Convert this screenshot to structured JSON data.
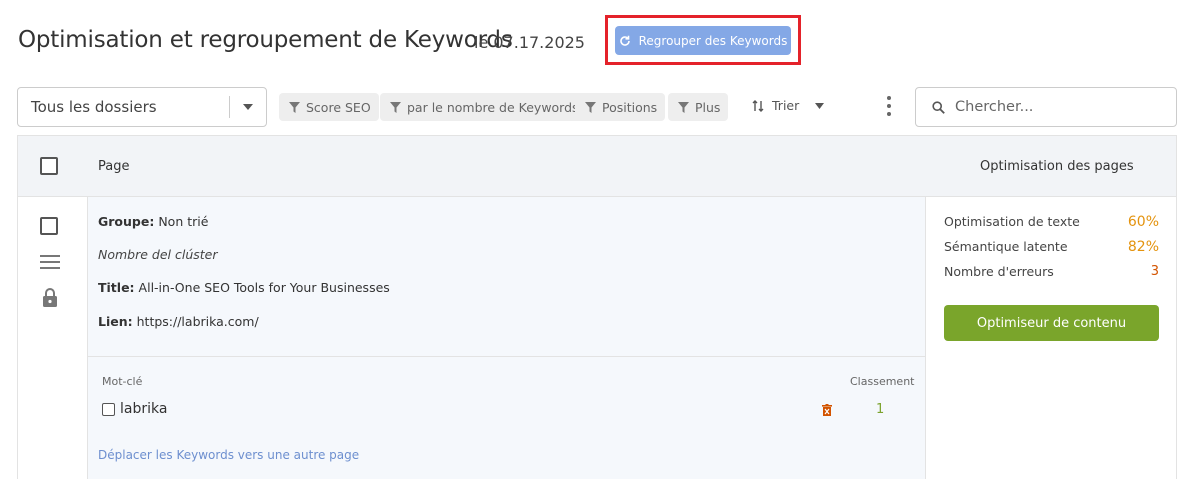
{
  "header": {
    "title": "Optimisation et regroupement de Keywords",
    "date": "le 07.17.2025",
    "regroup_button": "Regrouper des Keywords"
  },
  "toolbar": {
    "folder_select": "Tous les dossiers",
    "filters": [
      "Score SEO",
      "par le nombre de Keywords",
      "Positions",
      "Plus"
    ],
    "sort_label": "Trier",
    "search_placeholder": "Chercher..."
  },
  "table": {
    "col_page": "Page",
    "col_optimisation": "Optimisation des pages",
    "row": {
      "group_label": "Groupe:",
      "group_value": "Non trié",
      "cluster_name": "Nombre del clúster",
      "title_label": "Title:",
      "title_value": "All-in-One SEO Tools for Your Businesses",
      "link_label": "Lien:",
      "link_value": "https://labrika.com/",
      "keywords_header": "Mot-clé",
      "ranking_header": "Classement",
      "keywords": [
        {
          "text": "labrika",
          "rank": "1"
        }
      ],
      "move_link": "Déplacer les Keywords vers une autre page",
      "metrics": [
        {
          "label": "Optimisation de texte",
          "value": "60%"
        },
        {
          "label": "Sémantique latente",
          "value": "82%"
        },
        {
          "label": "Nombre d'erreurs",
          "value": "3"
        }
      ],
      "optimizer_button": "Optimiseur de contenu"
    }
  },
  "colors": {
    "primary_button": "#84a8e6",
    "highlight_border": "#e4222a",
    "green_button": "#7aa52b",
    "metric_value": "#e4930e",
    "link": "#6d8fcf"
  }
}
